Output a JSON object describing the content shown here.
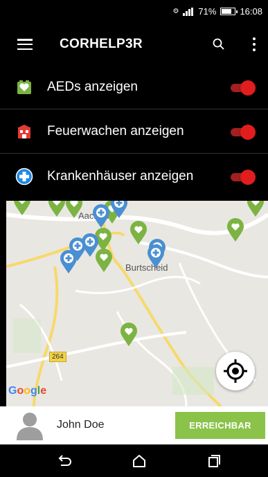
{
  "status_bar": {
    "battery": "71%",
    "time": "16:08",
    "icons": [
      "usb-debug-icon",
      "signal-icon",
      "battery-icon"
    ]
  },
  "app_bar": {
    "title": "CORHELP3R",
    "icons": [
      "menu-icon",
      "search-icon",
      "more-vert-icon"
    ]
  },
  "toggles": [
    {
      "label": "AEDs anzeigen",
      "icon": "aed-heart-icon",
      "icon_color": "#7cb342",
      "enabled": true
    },
    {
      "label": "Feuerwachen anzeigen",
      "icon": "fire-station-icon",
      "icon_color": "#e53935",
      "enabled": true
    },
    {
      "label": "Krankenhäuser anzeigen",
      "icon": "hospital-cross-icon",
      "icon_color": "#1e88e5",
      "enabled": true
    }
  ],
  "map": {
    "labels": [
      "Aachen",
      "Burtscheid"
    ],
    "road_number": "264",
    "attribution": "Google",
    "pin_colors": {
      "aed": "#7cb342",
      "hospital": "#4a8fd1"
    }
  },
  "user": {
    "name": "John Doe",
    "status_button": "ERREICHBAR"
  },
  "nav": [
    "back-icon",
    "home-icon",
    "recents-icon"
  ],
  "colors": {
    "switch_on": "#e11d1d",
    "accent_green": "#8bc34a"
  }
}
